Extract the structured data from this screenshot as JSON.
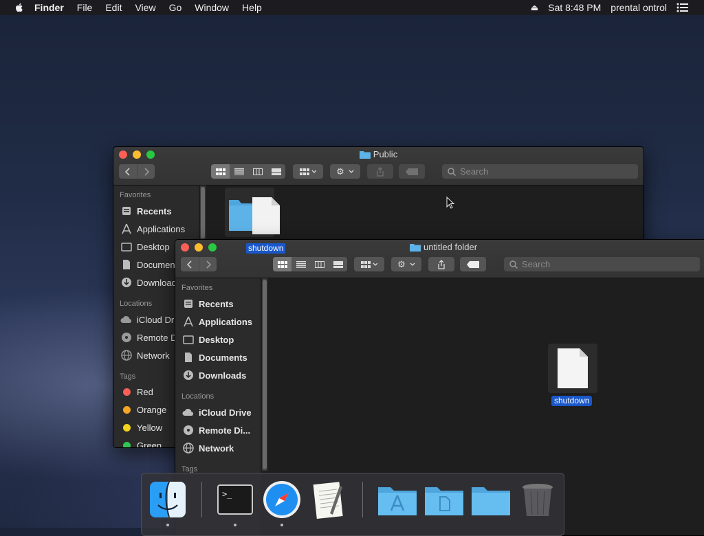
{
  "menubar": {
    "app": "Finder",
    "items": [
      "File",
      "Edit",
      "View",
      "Go",
      "Window",
      "Help"
    ],
    "clock": "Sat 8:48 PM",
    "user": "prental ontrol"
  },
  "back_window": {
    "title": "Public",
    "search_placeholder": "Search",
    "sidebar": {
      "favorites_header": "Favorites",
      "favorites": [
        "Recents",
        "Applications",
        "Desktop",
        "Documents",
        "Downloads"
      ],
      "locations_header": "Locations",
      "locations": [
        "iCloud Drive",
        "Remote Disc",
        "Network"
      ],
      "tags_header": "Tags",
      "tags": [
        {
          "label": "Red",
          "color": "#fc5f57"
        },
        {
          "label": "Orange",
          "color": "#f6a623"
        },
        {
          "label": "Yellow",
          "color": "#f3d31c"
        },
        {
          "label": "Green",
          "color": "#31c552"
        }
      ]
    }
  },
  "front_window": {
    "title": "untitled folder",
    "rename_label": "shutdown",
    "search_placeholder": "Search",
    "sidebar": {
      "favorites_header": "Favorites",
      "favorites": [
        "Recents",
        "Applications",
        "Desktop",
        "Documents",
        "Downloads"
      ],
      "locations_header": "Locations",
      "locations": [
        "iCloud Drive",
        "Remote Di...",
        "Network"
      ],
      "tags_header": "Tags"
    },
    "file": {
      "name": "shutdown"
    }
  },
  "dock": {
    "items": [
      "finder-icon",
      "terminal-icon",
      "safari-icon",
      "textedit-icon",
      "applications-folder-icon",
      "documents-folder-icon",
      "folder-icon",
      "trash-icon"
    ]
  },
  "colors": {
    "accent": "#1a57c9",
    "folder": "#5db3e8",
    "window_bg": "#1e1e1e",
    "sidebar_bg": "#2b2b2b"
  }
}
